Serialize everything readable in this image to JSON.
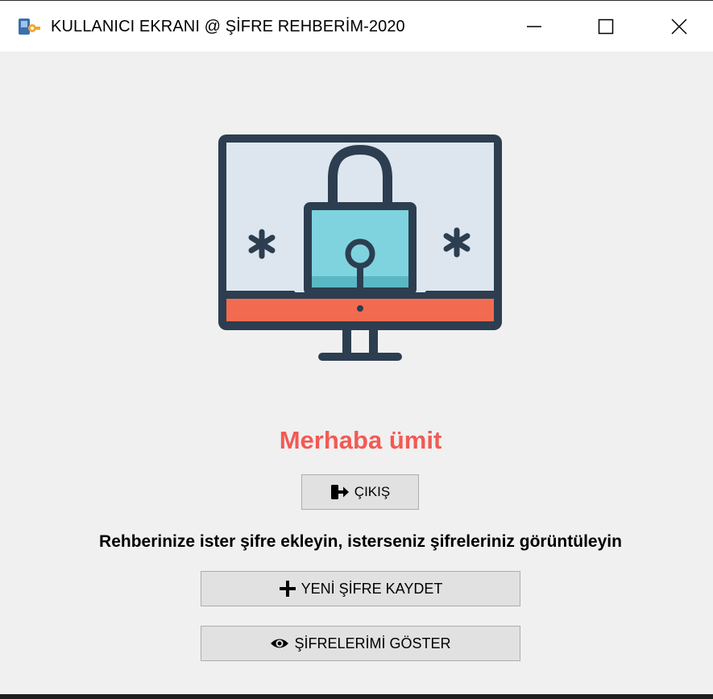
{
  "window": {
    "title": "KULLANICI EKRANI @ ŞİFRE REHBERİM-2020",
    "icon": "app-key-icon",
    "controls": [
      "minimize-icon",
      "maximize-icon",
      "close-icon"
    ]
  },
  "illustration": {
    "icon": "monitor-padlock-icon",
    "colors": {
      "frame": "#2c3e50",
      "screen": "#dde6ee",
      "lock_body": "#7fd3df",
      "base_bar": "#f26b50"
    }
  },
  "greeting": "Merhaba ümit",
  "exit_button": {
    "label": "ÇIKIŞ",
    "icon": "sign-out-icon"
  },
  "info_text": "Rehberinize ister şifre ekleyin, isterseniz şifreleriniz görüntüleyin",
  "new_password_button": {
    "label": "YENİ ŞİFRE KAYDET",
    "icon": "plus-icon"
  },
  "show_passwords_button": {
    "label": "ŞİFRELERİMİ GÖSTER",
    "icon": "eye-icon"
  },
  "colors": {
    "greeting": "#f25a55",
    "window_bg": "#f0f0f0",
    "button_bg": "#e1e1e1",
    "button_border": "#adadad"
  }
}
